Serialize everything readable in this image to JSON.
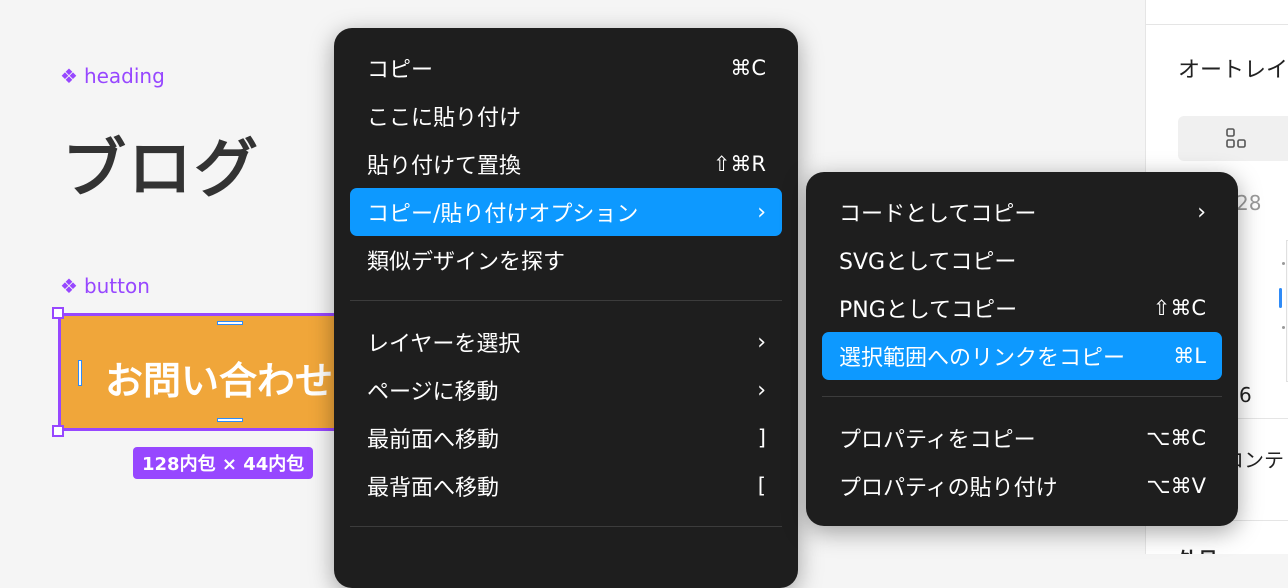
{
  "canvas": {
    "heading_label": "heading",
    "heading_text": "ブログ",
    "button_label": "button",
    "button_text": "お問い合わせ",
    "size_badge": "128内包 × 44内包",
    "component_icon": "component-diamond-icon"
  },
  "context_menu": {
    "items": [
      {
        "label": "コピー",
        "shortcut": "⌘C"
      },
      {
        "label": "ここに貼り付け",
        "shortcut": ""
      },
      {
        "label": "貼り付けて置換",
        "shortcut": "⇧⌘R"
      },
      {
        "label": "コピー/貼り付けオプション",
        "shortcut": "›"
      },
      {
        "label": "類似デザインを探す",
        "shortcut": ""
      },
      {
        "label": "レイヤーを選択",
        "shortcut": "›"
      },
      {
        "label": "ページに移動",
        "shortcut": "›"
      },
      {
        "label": "最前面へ移動",
        "shortcut": "]"
      },
      {
        "label": "最背面へ移動",
        "shortcut": "["
      }
    ]
  },
  "submenu": {
    "items": [
      {
        "label": "コードとしてコピー",
        "shortcut": "›"
      },
      {
        "label": "SVGとしてコピー",
        "shortcut": ""
      },
      {
        "label": "PNGとしてコピー",
        "shortcut": "⇧⌘C"
      },
      {
        "label": "選択範囲へのリンクをコピー",
        "shortcut": "⌘L"
      },
      {
        "label": "プロパティをコピー",
        "shortcut": "⌥⌘C"
      },
      {
        "label": "プロパティの貼り付け",
        "shortcut": "⌥⌘V"
      }
    ]
  },
  "right_panel": {
    "auto_layout_title": "オートレイ",
    "layout_icon": "auto-layout-grid-icon",
    "gap_value": "28",
    "padding_value": "6",
    "content_label": "コンテ",
    "outer_label": "外見"
  },
  "colors": {
    "accent": "#0d99ff",
    "component": "#9747ff",
    "button_fill": "#f0a63a",
    "menu_bg": "#1e1e1e"
  }
}
